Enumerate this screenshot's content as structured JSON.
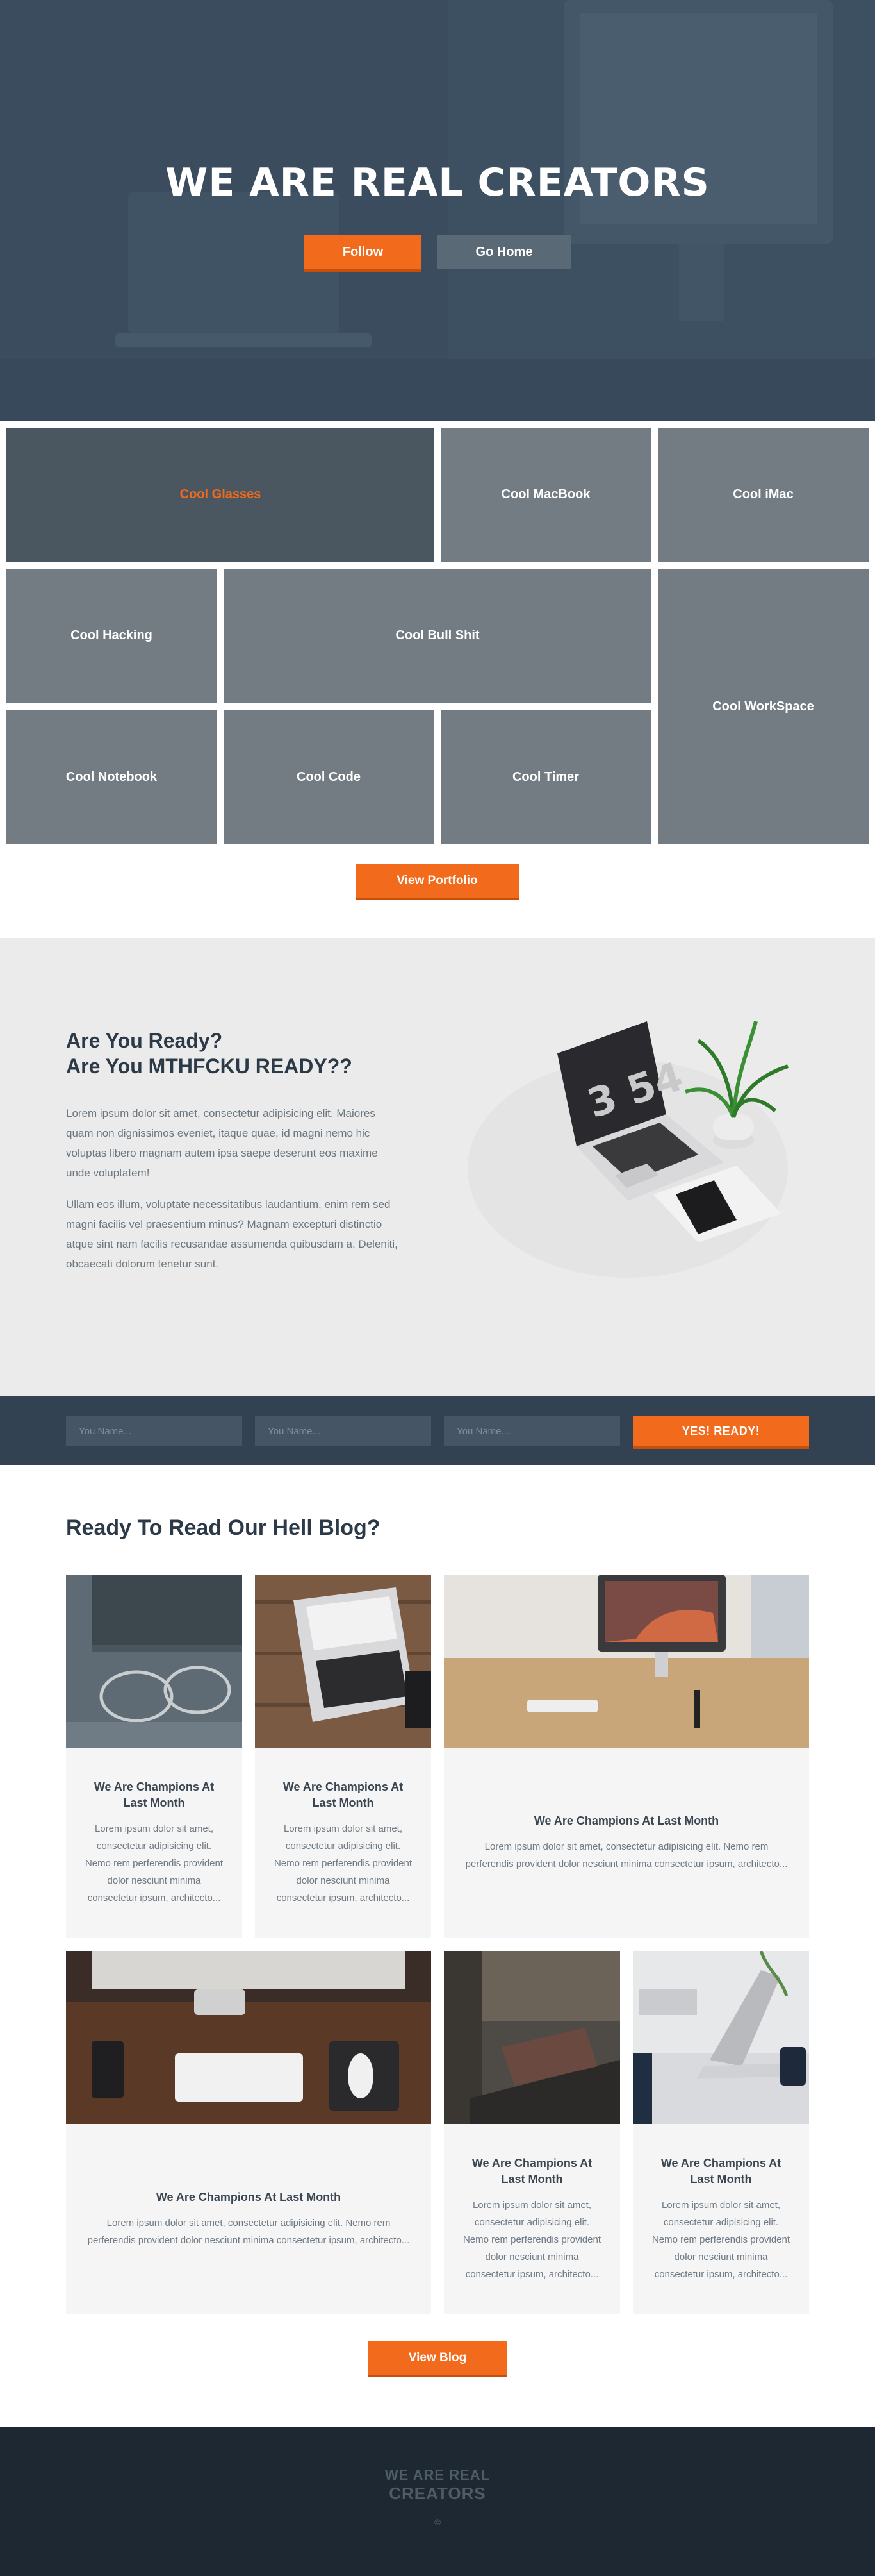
{
  "hero": {
    "title": "WE ARE REAL CREATORS",
    "follow_label": "Follow",
    "home_label": "Go Home"
  },
  "portfolio": {
    "tiles": [
      "Cool Glasses",
      "Cool MacBook",
      "Cool iMac",
      "Cool Hacking",
      "Cool Bull Shit",
      "Cool WorkSpace",
      "Cool Notebook",
      "Cool Code",
      "Cool Timer"
    ],
    "button_label": "View Portfolio"
  },
  "ready": {
    "heading_line1": "Are You Ready?",
    "heading_line2": "Are You MTHFCKU READY??",
    "paragraph1": "Lorem ipsum dolor sit amet, consectetur adipisicing elit. Maiores quam non dignissimos eveniet, itaque quae, id magni nemo hic voluptas libero magnam autem ipsa saepe deserunt eos maxime unde voluptatem!",
    "paragraph2": "Ullam eos illum, voluptate necessitatibus laudantium, enim rem sed magni facilis vel praesentium minus? Magnam excepturi distinctio atque sint nam facilis recusandae assumenda quibusdam a. Deleniti, obcaecati dolorum tenetur sunt.",
    "clock_digits": "3 54"
  },
  "subscribe": {
    "placeholders": [
      "You Name...",
      "You Name...",
      "You Name..."
    ],
    "button_label": "YES! READY!"
  },
  "blog": {
    "heading": "Ready To Read Our Hell Blog?",
    "cards": [
      {
        "title": "We Are Champions At Last Month",
        "body": "Lorem ipsum dolor sit amet, consectetur adipisicing elit. Nemo rem perferendis provident dolor nesciunt minima consectetur ipsum, architecto..."
      },
      {
        "title": "We Are Champions At Last Month",
        "body": "Lorem ipsum dolor sit amet, consectetur adipisicing elit. Nemo rem perferendis provident dolor nesciunt minima consectetur ipsum, architecto..."
      },
      {
        "title": "We Are Champions At Last Month",
        "body": "Lorem ipsum dolor sit amet, consectetur adipisicing elit. Nemo rem perferendis provident dolor nesciunt minima consectetur ipsum, architecto..."
      },
      {
        "title": "We Are Champions At Last Month",
        "body": "Lorem ipsum dolor sit amet, consectetur adipisicing elit. Nemo rem perferendis provident dolor nesciunt minima consectetur ipsum, architecto..."
      },
      {
        "title": "We Are Champions At Last Month",
        "body": "Lorem ipsum dolor sit amet, consectetur adipisicing elit. Nemo rem perferendis provident dolor nesciunt minima consectetur ipsum, architecto..."
      },
      {
        "title": "We Are Champions At Last Month",
        "body": "Lorem ipsum dolor sit amet, consectetur adipisicing elit. Nemo rem perferendis provident dolor nesciunt minima consectetur ipsum, architecto..."
      }
    ],
    "button_label": "View Blog"
  },
  "footer": {
    "logo_line1": "WE ARE REAL",
    "logo_line2": "CREATORS",
    "copyright": "—©—"
  },
  "colors": {
    "accent": "#f26a1b",
    "hero_overlay": "#3c4e5e",
    "tile": "#737c82",
    "subscribe_bg": "#334252",
    "footer_bg": "#1e2832"
  }
}
